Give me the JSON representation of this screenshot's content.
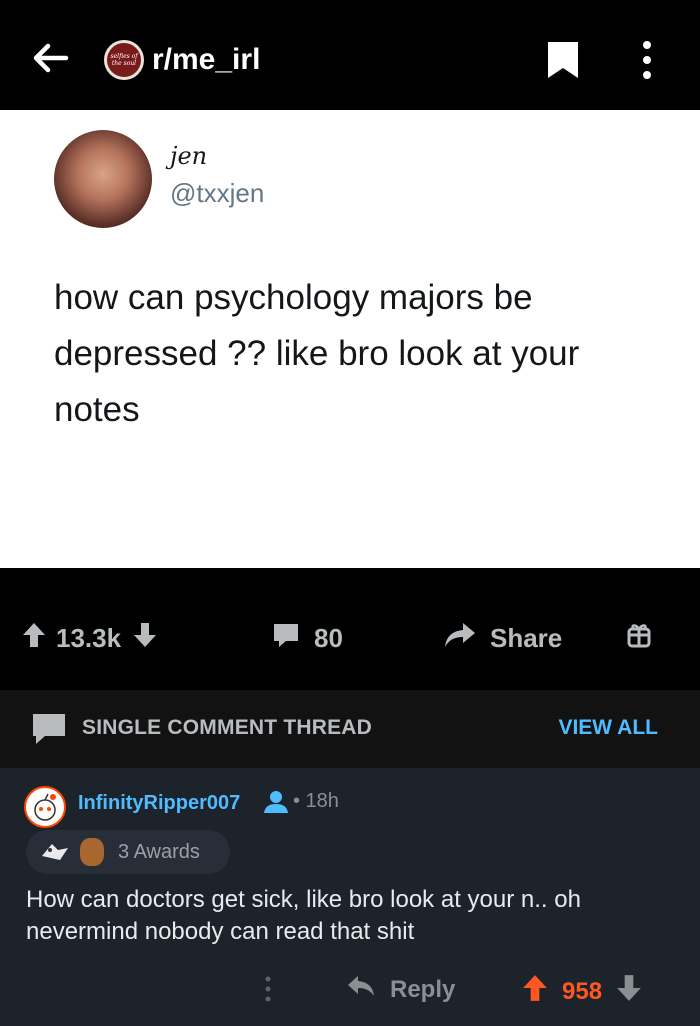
{
  "header": {
    "subreddit": "r/me_irl",
    "sub_icon_text": "selfies of the soul"
  },
  "tweet": {
    "name": "jen",
    "handle": "@txxjen",
    "text": "how can psychology majors be depressed ?? like bro look at your notes"
  },
  "actions": {
    "upvotes": "13.3k",
    "comments": "80",
    "share_label": "Share"
  },
  "thread": {
    "title": "SINGLE COMMENT THREAD",
    "view_all": "VIEW ALL"
  },
  "comment": {
    "username": "InfinityRipper007",
    "time": "• 18h",
    "awards": "3 Awards",
    "body": "How can doctors get sick, like bro look at your n.. oh nevermind nobody can read that shit",
    "reply_label": "Reply",
    "score": "958"
  },
  "colors": {
    "accent_blue": "#4fbcff",
    "upvote_orange": "#ff5722",
    "comment_bg": "#1d232b"
  }
}
